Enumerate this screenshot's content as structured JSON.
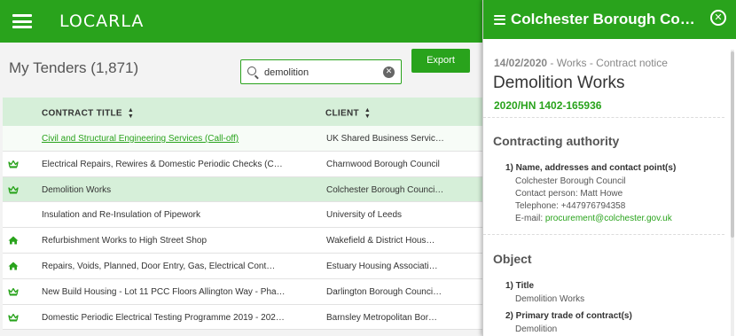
{
  "app": {
    "logo": "LOCARLA",
    "page_title": "My Tenders (1,871)",
    "search": {
      "value": "demolition",
      "placeholder": ""
    },
    "export_label": "Export",
    "table": {
      "headers": {
        "title": "CONTRACT TITLE",
        "client": "CLIENT"
      },
      "rows": [
        {
          "icon": "",
          "title": "Civil and Structural Engineering Services (Call-off)",
          "client": "UK Shared Business Servic…",
          "link": true
        },
        {
          "icon": "crown-icon",
          "title": "Electrical Repairs, Rewires & Domestic Periodic Checks (C…",
          "client": "Charnwood Borough Council"
        },
        {
          "icon": "crown-icon",
          "title": "Demolition Works",
          "client": "Colchester Borough Counci…",
          "selected": true
        },
        {
          "icon": "",
          "title": "Insulation and Re-Insulation of Pipework",
          "client": "University of Leeds"
        },
        {
          "icon": "house-icon",
          "title": "Refurbishment Works to High Street Shop",
          "client": "Wakefield & District Hous…"
        },
        {
          "icon": "house-icon",
          "title": "Repairs, Voids, Planned, Door Entry, Gas, Electrical Cont…",
          "client": "Estuary Housing Associati…"
        },
        {
          "icon": "crown-icon",
          "title": "New Build Housing - Lot 11 PCC Floors Allington Way - Pha…",
          "client": "Darlington Borough Counci…"
        },
        {
          "icon": "crown-icon",
          "title": "Domestic Periodic Electrical Testing Programme 2019 - 202…",
          "client": "Barnsley Metropolitan Bor…"
        }
      ]
    }
  },
  "panel": {
    "title": "Colchester Borough Co…",
    "date": "14/02/2020",
    "category": " - Works - Contract notice",
    "notice_title": "Demolition Works",
    "reference": "2020/HN 1402-165936",
    "sections": {
      "authority": {
        "heading": "Contracting authority",
        "item_label": "1) Name, addresses and contact point(s)",
        "lines": [
          "Colchester Borough Council",
          "Contact person: Matt Howe",
          "Telephone: +447976794358"
        ],
        "email_label": "E-mail: ",
        "email": "procurement@colchester.gov.uk"
      },
      "object": {
        "heading": "Object",
        "title_label": "1) Title",
        "title_value": "Demolition Works",
        "trade_label": "2) Primary trade of contract(s)",
        "trade_value": "Demolition"
      }
    }
  },
  "colors": {
    "brand_green": "#29a31c",
    "row_highlight": "#d6efd9"
  }
}
